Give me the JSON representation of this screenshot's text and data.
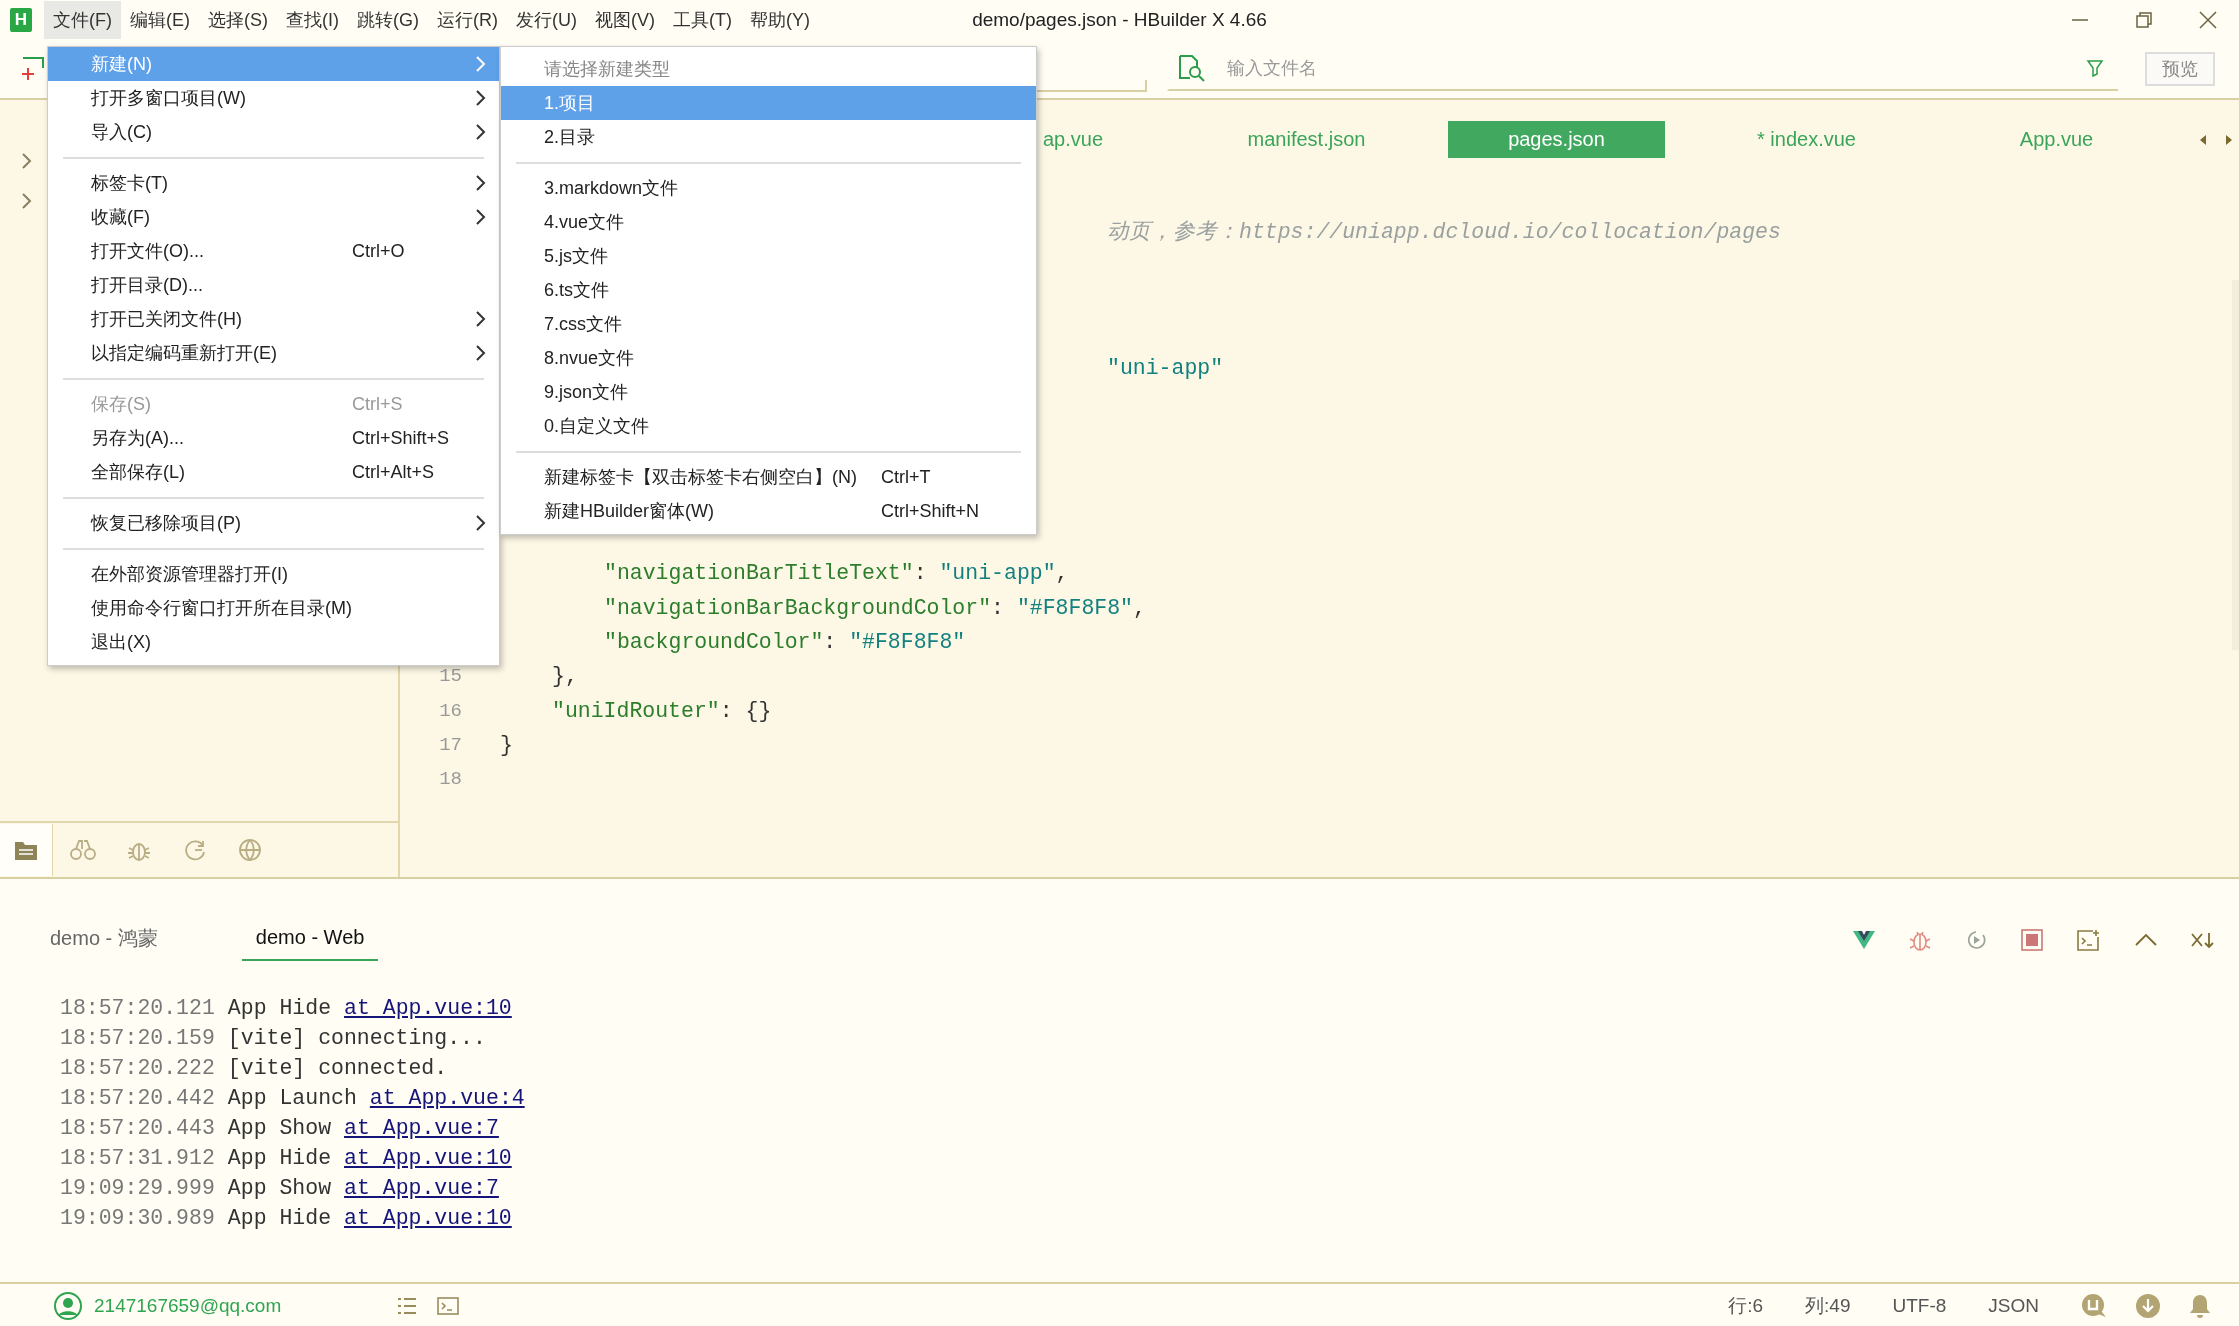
{
  "title_bar": {
    "logo": "H",
    "menus": [
      {
        "label": "文件(F)",
        "selected": true
      },
      {
        "label": "编辑(E)",
        "selected": false
      },
      {
        "label": "选择(S)",
        "selected": false
      },
      {
        "label": "查找(I)",
        "selected": false
      },
      {
        "label": "跳转(G)",
        "selected": false
      },
      {
        "label": "运行(R)",
        "selected": false
      },
      {
        "label": "发行(U)",
        "selected": false
      },
      {
        "label": "视图(V)",
        "selected": false
      },
      {
        "label": "工具(T)",
        "selected": false
      },
      {
        "label": "帮助(Y)",
        "selected": false
      }
    ],
    "title": "demo/pages.json - HBuilder X 4.66"
  },
  "toolbar": {
    "search": {
      "placeholder": "输入文件名"
    },
    "preview_button": "预览"
  },
  "file_menu": [
    {
      "kind": "item",
      "label": "新建(N)",
      "submenu": true,
      "disabled": false,
      "selected": true
    },
    {
      "kind": "item",
      "label": "打开多窗口项目(W)",
      "submenu": true,
      "disabled": false,
      "selected": false
    },
    {
      "kind": "item",
      "label": "导入(C)",
      "submenu": true,
      "disabled": false,
      "selected": false
    },
    {
      "kind": "separator"
    },
    {
      "kind": "item",
      "label": "标签卡(T)",
      "submenu": true,
      "disabled": false,
      "selected": false
    },
    {
      "kind": "item",
      "label": "收藏(F)",
      "submenu": true,
      "disabled": false,
      "selected": false
    },
    {
      "kind": "item",
      "label": "打开文件(O)...",
      "shortcut": "Ctrl+O",
      "submenu": false,
      "disabled": false,
      "selected": false
    },
    {
      "kind": "item",
      "label": "打开目录(D)...",
      "submenu": false,
      "disabled": false,
      "selected": false
    },
    {
      "kind": "item",
      "label": "打开已关闭文件(H)",
      "submenu": true,
      "disabled": false,
      "selected": false
    },
    {
      "kind": "item",
      "label": "以指定编码重新打开(E)",
      "submenu": true,
      "disabled": false,
      "selected": false
    },
    {
      "kind": "separator"
    },
    {
      "kind": "item",
      "label": "保存(S)",
      "shortcut": "Ctrl+S",
      "submenu": false,
      "disabled": true,
      "selected": false
    },
    {
      "kind": "item",
      "label": "另存为(A)...",
      "shortcut": "Ctrl+Shift+S",
      "submenu": false,
      "disabled": false,
      "selected": false
    },
    {
      "kind": "item",
      "label": "全部保存(L)",
      "shortcut": "Ctrl+Alt+S",
      "submenu": false,
      "disabled": false,
      "selected": false
    },
    {
      "kind": "separator"
    },
    {
      "kind": "item",
      "label": "恢复已移除项目(P)",
      "submenu": true,
      "disabled": false,
      "selected": false
    },
    {
      "kind": "separator"
    },
    {
      "kind": "item",
      "label": "在外部资源管理器打开(I)",
      "submenu": false,
      "disabled": false,
      "selected": false
    },
    {
      "kind": "item",
      "label": "使用命令行窗口打开所在目录(M)",
      "submenu": false,
      "disabled": false,
      "selected": false
    },
    {
      "kind": "item",
      "label": "退出(X)",
      "submenu": false,
      "disabled": false,
      "selected": false
    }
  ],
  "new_menu": {
    "header": "请选择新建类型",
    "items": [
      {
        "kind": "item",
        "label": "1.项目",
        "selected": true
      },
      {
        "kind": "item",
        "label": "2.目录",
        "selected": false
      },
      {
        "kind": "separator"
      },
      {
        "kind": "item",
        "label": "3.markdown文件",
        "selected": false
      },
      {
        "kind": "item",
        "label": "4.vue文件",
        "selected": false
      },
      {
        "kind": "item",
        "label": "5.js文件",
        "selected": false
      },
      {
        "kind": "item",
        "label": "6.ts文件",
        "selected": false
      },
      {
        "kind": "item",
        "label": "7.css文件",
        "selected": false
      },
      {
        "kind": "item",
        "label": "8.nvue文件",
        "selected": false
      },
      {
        "kind": "item",
        "label": "9.json文件",
        "selected": false
      },
      {
        "kind": "item",
        "label": "0.自定义文件",
        "selected": false
      },
      {
        "kind": "separator"
      },
      {
        "kind": "item",
        "label": "新建标签卡【双击标签卡右侧空白】(N)",
        "shortcut": "Ctrl+T",
        "selected": false
      },
      {
        "kind": "item",
        "label": "新建HBuilder窗体(W)",
        "shortcut": "Ctrl+Shift+N",
        "selected": false
      }
    ]
  },
  "sidebar": {
    "tabs": [
      {
        "selected": true
      },
      {
        "selected": false
      },
      {
        "selected": false
      },
      {
        "selected": false
      },
      {
        "selected": false
      }
    ]
  },
  "editor": {
    "tabs": [
      {
        "label": "ap.vue",
        "selected": false
      },
      {
        "label": "manifest.json",
        "selected": false
      },
      {
        "label": "pages.json",
        "selected": true
      },
      {
        "label": "* index.vue",
        "selected": false
      },
      {
        "label": "App.vue",
        "selected": false
      }
    ],
    "lines": [
      {
        "kind": "partial",
        "tokens": [
          {
            "kind": "comment",
            "text": "动页，参考：https://uniapp.dcloud.io/collocation/pages"
          }
        ]
      },
      {
        "kind": "partial",
        "tokens": [
          {
            "kind": "string",
            "text": "\"uni-app\""
          }
        ]
      },
      {
        "kind": "nested",
        "tokens": [
          {
            "kind": "key",
            "text": "\"navigationBarTitleText\""
          },
          {
            "kind": "plain",
            "text": ": "
          },
          {
            "kind": "string",
            "text": "\"uni-app\""
          },
          {
            "kind": "plain",
            "text": ","
          }
        ]
      },
      {
        "kind": "nested",
        "tokens": [
          {
            "kind": "key",
            "text": "\"navigationBarBackgroundColor\""
          },
          {
            "kind": "plain",
            "text": ": "
          },
          {
            "kind": "string",
            "text": "\"#F8F8F8\""
          },
          {
            "kind": "plain",
            "text": ","
          }
        ]
      },
      {
        "kind": "nested",
        "tokens": [
          {
            "kind": "key",
            "text": "\"backgroundColor\""
          },
          {
            "kind": "plain",
            "text": ": "
          },
          {
            "kind": "string",
            "text": "\"#F8F8F8\""
          }
        ]
      },
      {
        "kind": "inner",
        "number": "15",
        "tokens": [
          {
            "kind": "plain",
            "text": "},"
          }
        ]
      },
      {
        "kind": "inner",
        "number": "16",
        "tokens": [
          {
            "kind": "key",
            "text": "\"uniIdRouter\""
          },
          {
            "kind": "plain",
            "text": ": {}"
          }
        ]
      },
      {
        "kind": "outer",
        "number": "17",
        "tokens": [
          {
            "kind": "plain",
            "text": "}"
          }
        ]
      },
      {
        "number": "18"
      }
    ]
  },
  "console": {
    "tabs": [
      {
        "label": "demo - 鸿蒙",
        "selected": false
      },
      {
        "label": "demo - Web",
        "selected": true
      }
    ],
    "log": [
      {
        "time": "18:57:20.121",
        "message": "App Hide",
        "link": "at App.vue:10"
      },
      {
        "time": "18:57:20.159",
        "message": "[vite] connecting..."
      },
      {
        "time": "18:57:20.222",
        "message": "[vite] connected."
      },
      {
        "time": "18:57:20.442",
        "message": "App Launch",
        "link": "at App.vue:4"
      },
      {
        "time": "18:57:20.443",
        "message": "App Show",
        "link": "at App.vue:7"
      },
      {
        "time": "18:57:31.912",
        "message": "App Hide",
        "link": "at App.vue:10"
      },
      {
        "time": "19:09:29.999",
        "message": "App Show",
        "link": "at App.vue:7"
      },
      {
        "time": "19:09:30.989",
        "message": "App Hide",
        "link": "at App.vue:10"
      }
    ]
  },
  "status_bar": {
    "account": "2147167659@qq.com",
    "line": "行:6",
    "column": "列:49",
    "encoding": "UTF-8",
    "language": "JSON"
  }
}
